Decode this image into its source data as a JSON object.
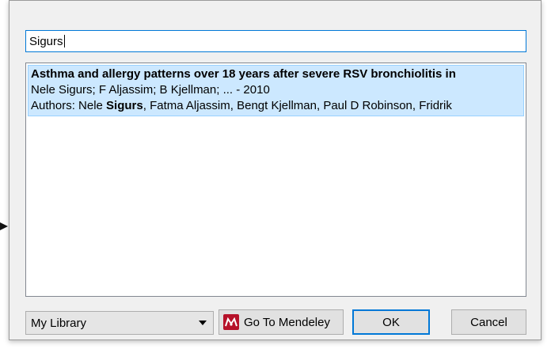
{
  "search": {
    "value": "Sigurs"
  },
  "results": [
    {
      "title": "Asthma and allergy patterns over 18 years after severe RSV bronchiolitis in",
      "citation": "Nele Sigurs; F Aljassim; B Kjellman; ... - 2010",
      "authors_prefix": "Authors: Nele ",
      "authors_match": "Sigurs",
      "authors_suffix": ", Fatma Aljassim, Bengt Kjellman, Paul D Robinson, Fridrik"
    }
  ],
  "footer": {
    "library": "My Library",
    "goto_label": "Go To Mendeley",
    "ok_label": "OK",
    "cancel_label": "Cancel"
  },
  "colors": {
    "selection": "#cce8ff",
    "accent": "#0078d7",
    "mendeley": "#b6122a"
  }
}
